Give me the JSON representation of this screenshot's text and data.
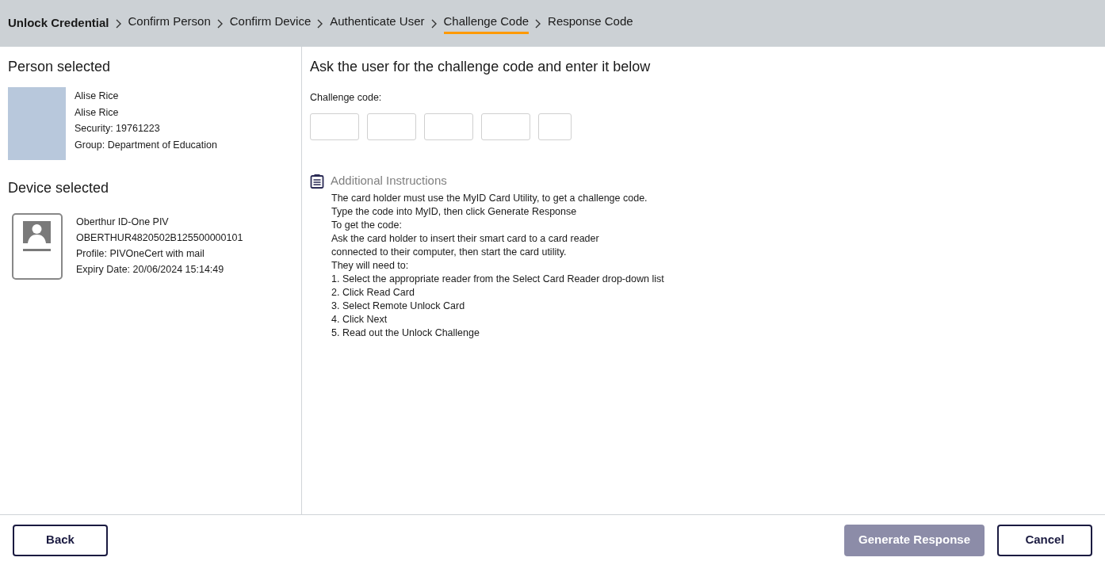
{
  "breadcrumb": {
    "title": "Unlock Credential",
    "steps": [
      {
        "label": "Confirm Person",
        "selected": false
      },
      {
        "label": "Confirm Device",
        "selected": false
      },
      {
        "label": "Authenticate User",
        "selected": false
      },
      {
        "label": "Challenge Code",
        "selected": true
      },
      {
        "label": "Response Code",
        "selected": false
      }
    ]
  },
  "person": {
    "heading": "Person selected",
    "lines": [
      "Alise Rice",
      "Alise Rice",
      "Security: 19761223",
      "Group: Department of Education"
    ]
  },
  "device": {
    "heading": "Device selected",
    "lines": [
      "Oberthur ID-One PIV",
      "OBERTHUR4820502B125500000101",
      "Profile: PIVOneCert with mail",
      "Expiry Date: 20/06/2024 15:14:49"
    ]
  },
  "challenge": {
    "heading": "Ask the user for the challenge code and enter it below",
    "label": "Challenge code:",
    "fields": [
      {
        "kind": "wide"
      },
      {
        "kind": "wide"
      },
      {
        "kind": "wide"
      },
      {
        "kind": "wide"
      },
      {
        "kind": "narrow"
      }
    ]
  },
  "instructions": {
    "title": "Additional Instructions",
    "lines": [
      "The card holder must use the MyID Card Utility, to get a challenge code.",
      "Type the code into MyID, then click Generate Response",
      "To get the code:",
      "Ask the card holder to insert their smart card to a card reader",
      "connected to their computer, then start the card utility.",
      "They will need to:",
      "1. Select the appropriate reader from the Select Card Reader drop-down list",
      "2. Click Read Card",
      "3. Select Remote Unlock Card",
      "4. Click Next",
      "5. Read out the Unlock Challenge"
    ]
  },
  "footer": {
    "left": [
      {
        "label": "Back",
        "disabled": false
      }
    ],
    "right": [
      {
        "label": "Generate Response",
        "disabled": true
      },
      {
        "label": "Cancel",
        "disabled": false
      }
    ]
  }
}
